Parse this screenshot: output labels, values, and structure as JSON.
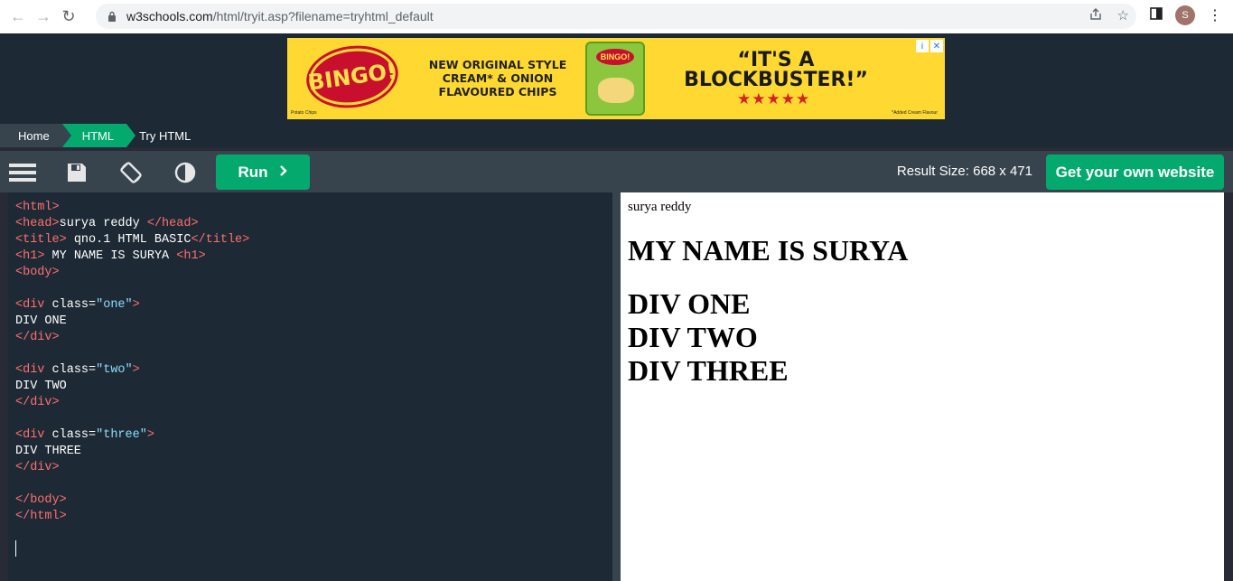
{
  "browser": {
    "url_host": "w3schools.com",
    "url_path": "/html/tryit.asp?filename=tryhtml_default",
    "profile_initial": "S"
  },
  "ad": {
    "brand": "BINGO!",
    "line1": "NEW ORIGINAL STYLE",
    "line2": "CREAM* & ONION",
    "line3": "FLAVOURED CHIPS",
    "headline1": "“IT'S A",
    "headline2": "BLOCKBUSTER!”",
    "stars": "★★★★★",
    "footnote": "*Added Cream Flavour",
    "pack_label": "Potato Chips"
  },
  "breadcrumb": {
    "home": "Home",
    "html": "HTML",
    "current": "Try HTML"
  },
  "toolbar": {
    "run_label": "Run",
    "result_size": "Result Size: 668 x 471",
    "own_website": "Get your own website"
  },
  "editor": {
    "lines": [
      "<html>",
      "<head>surya reddy </head>",
      "<title> qno.1 HTML BASIC</title>",
      "<h1> MY NAME IS SURYA <h1>",
      "<body>",
      "",
      "<div class=\"one\">",
      "DIV ONE",
      "</div>",
      "",
      "<div class=\"two\">",
      "DIV TWO",
      "</div>",
      "",
      "<div class=\"three\">",
      "DIV THREE",
      "</div>",
      "",
      "</body>",
      "</html>"
    ]
  },
  "result": {
    "head_text": "surya reddy",
    "heading": "MY NAME IS SURYA",
    "div_one": "DIV ONE",
    "div_two": "DIV TWO",
    "div_three": "DIV THREE"
  }
}
